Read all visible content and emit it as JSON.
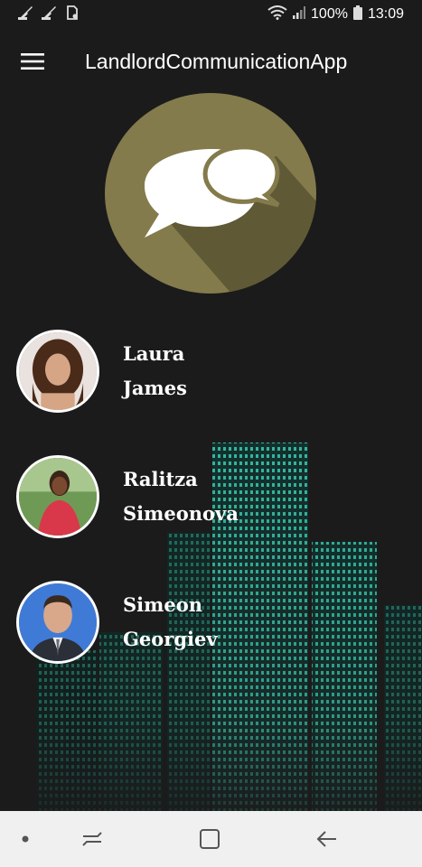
{
  "status_bar": {
    "battery": "100%",
    "time": "13:09",
    "icons": [
      "broom-icon",
      "broom-icon",
      "sd-card-icon",
      "wifi-icon",
      "signal-icon",
      "battery-icon"
    ]
  },
  "app_bar": {
    "title": "LandlordCommunicationApp",
    "menu_icon": "hamburger-menu-icon"
  },
  "logo": {
    "icon": "chat-bubbles-icon",
    "circle_color": "#847b4c",
    "shadow_color": "#5f5935"
  },
  "contacts": [
    {
      "first_name": "Laura",
      "last_name": "James",
      "avatar_bg": "#caa58a"
    },
    {
      "first_name": "Ralitza",
      "last_name": "Simeonova",
      "avatar_bg": "#6f9a55"
    },
    {
      "first_name": "Simeon",
      "last_name": "Georgiev",
      "avatar_bg": "#3f7bd6"
    }
  ],
  "nav_bar": {
    "items": [
      "dot-icon",
      "recent-apps-icon",
      "home-icon",
      "back-icon"
    ]
  },
  "colors": {
    "background": "#1b1b1b",
    "city_windows": "#38c6b0",
    "nav_bg": "#f0f0f0"
  }
}
